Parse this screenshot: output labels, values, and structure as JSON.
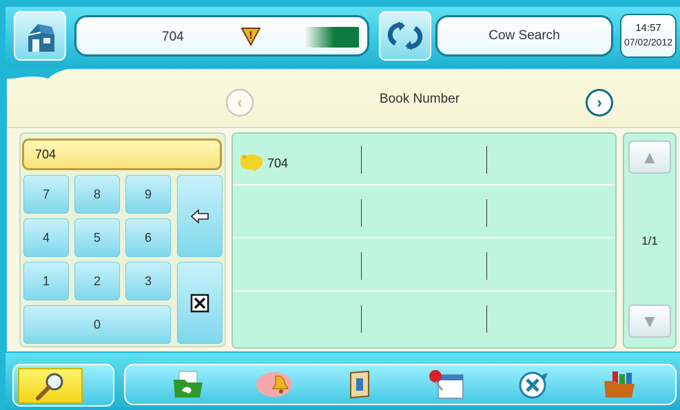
{
  "header": {
    "cow_number": "704",
    "title": "Cow Search",
    "time": "14:57",
    "date": "07/02/2012"
  },
  "selector": {
    "label": "Book Number",
    "prev_icon": "chevron-left-icon",
    "next_icon": "chevron-right-icon"
  },
  "keypad": {
    "display_value": "704",
    "keys": [
      "7",
      "8",
      "9",
      "4",
      "5",
      "6",
      "1",
      "2",
      "3",
      "0"
    ],
    "backspace_icon": "backspace-arrow-icon",
    "clear_icon": "clear-x-icon"
  },
  "results": {
    "rows": [
      {
        "icon": "cow-icon",
        "value": "704"
      },
      {
        "icon": "",
        "value": ""
      },
      {
        "icon": "",
        "value": ""
      },
      {
        "icon": "",
        "value": ""
      }
    ]
  },
  "pager": {
    "page": "1/1"
  },
  "bottom_nav": {
    "items": [
      "search-icon",
      "calf-folder-icon",
      "alarm-cow-icon",
      "book-icon",
      "calendar-pin-icon",
      "heat-icon",
      "report-folder-icon"
    ]
  },
  "colors": {
    "accent": "#22b6d6",
    "list_bg": "#bff5df",
    "display_bg": "#fff3a0",
    "progress_green": "#0d7a3e"
  }
}
